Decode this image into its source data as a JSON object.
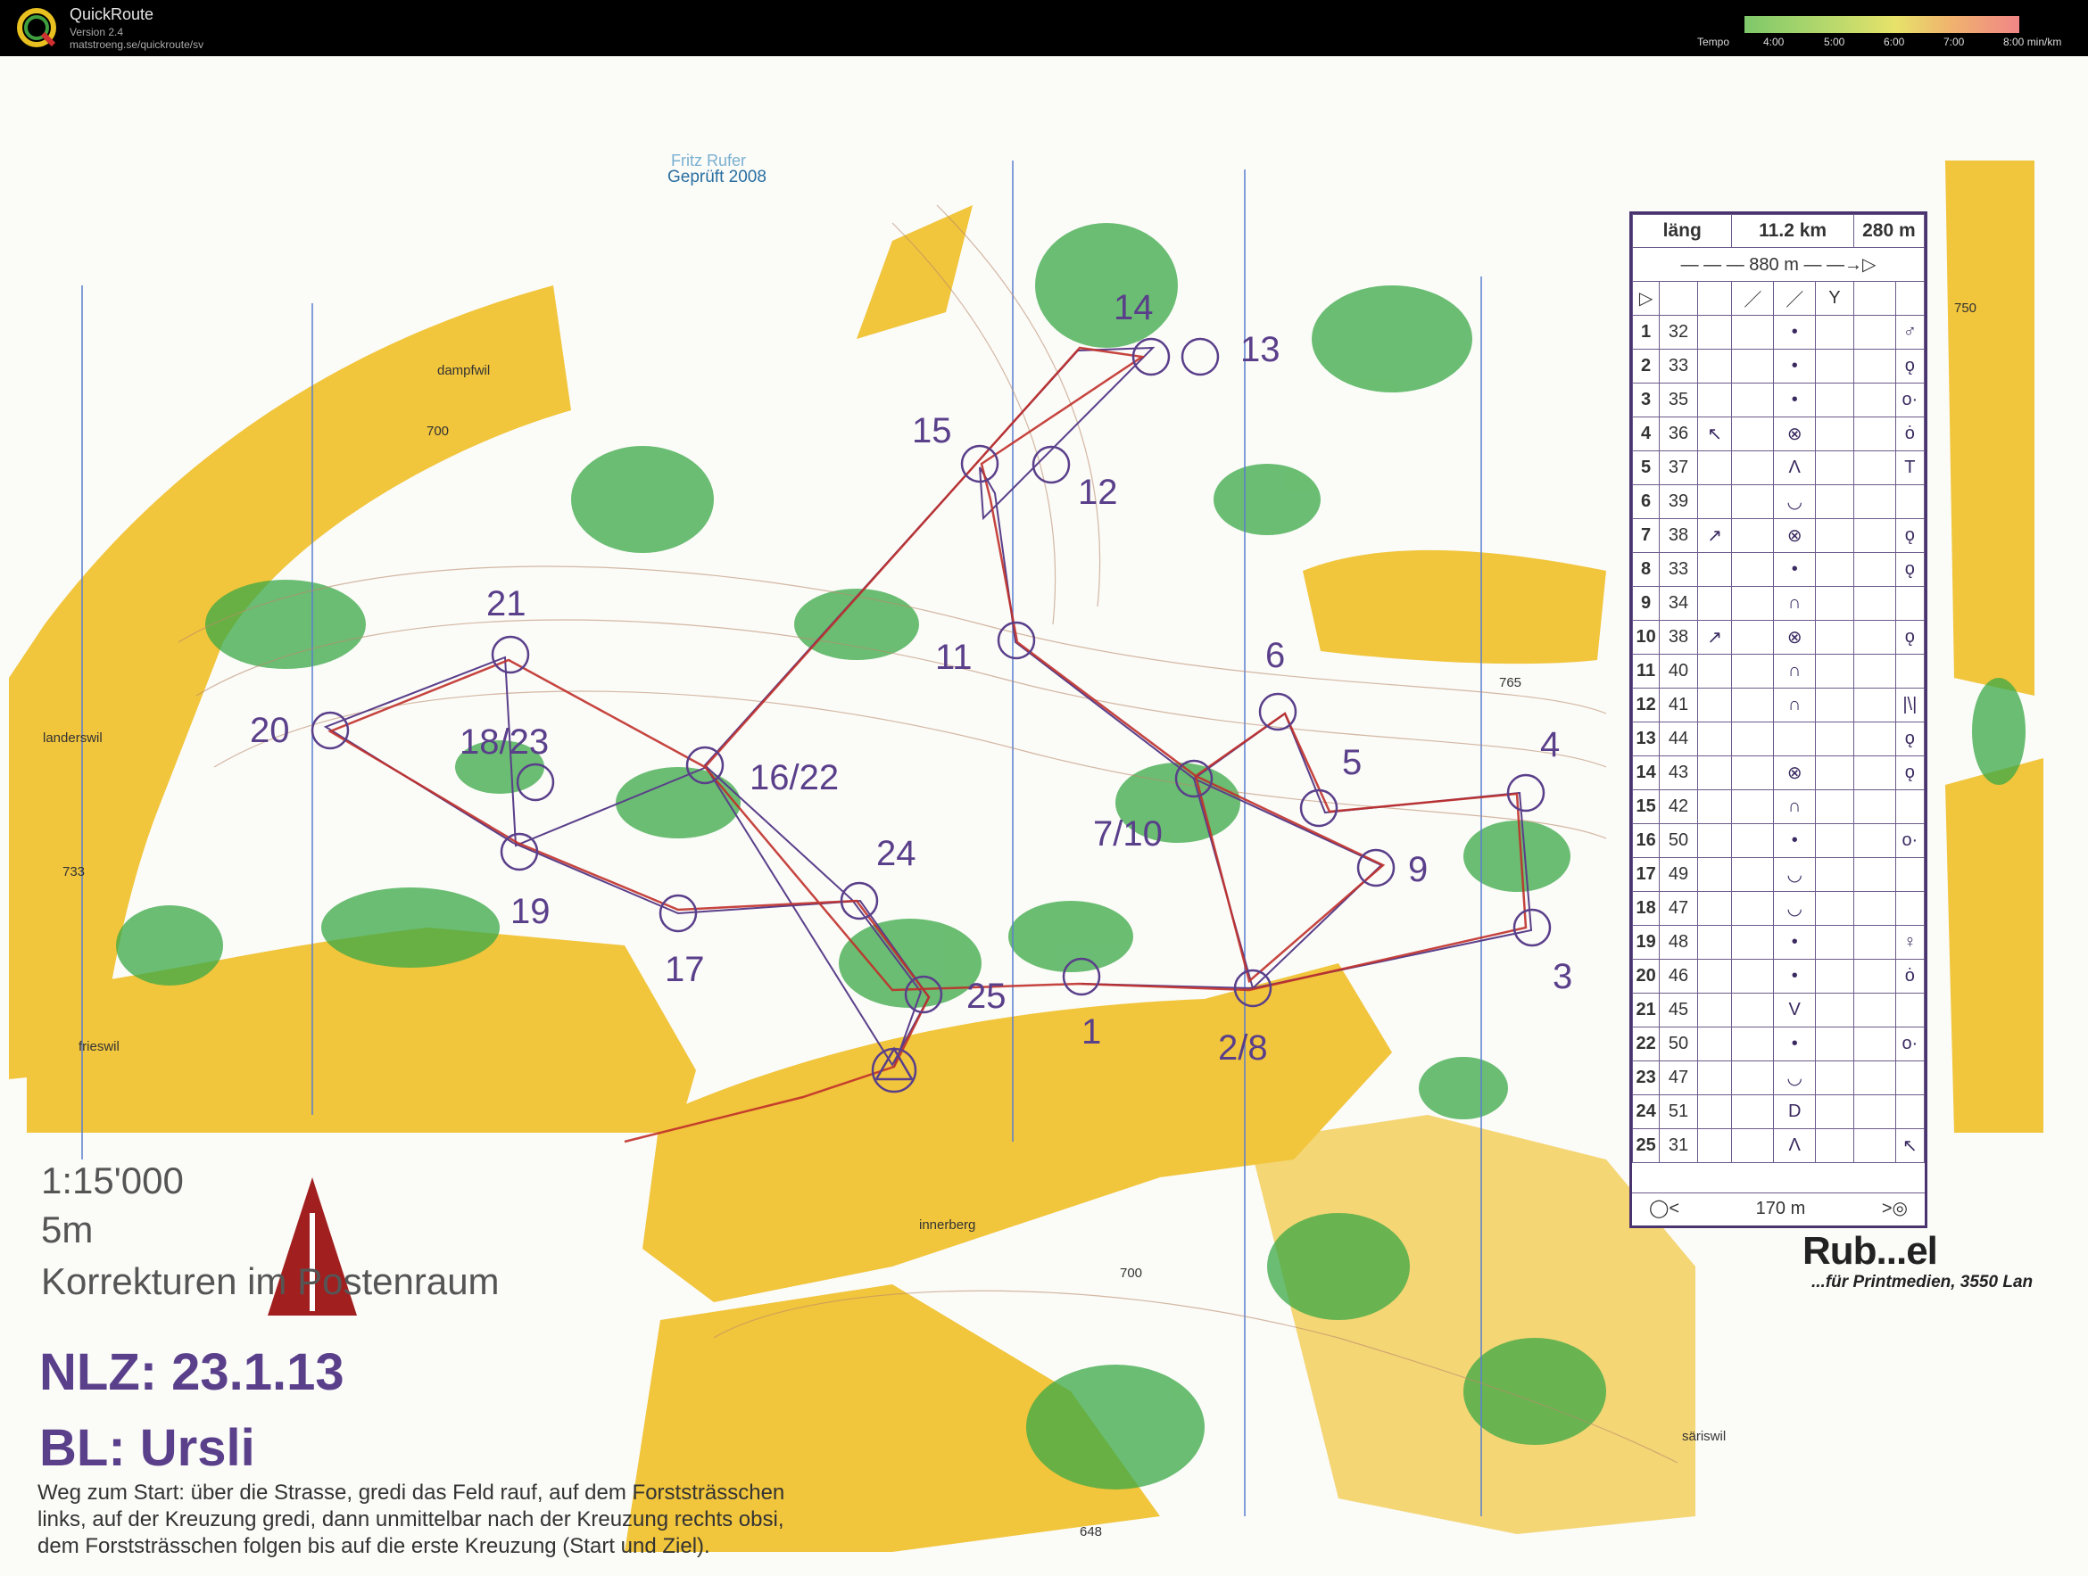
{
  "app": {
    "name": "QuickRoute",
    "version": "Version 2.4",
    "url": "matstroeng.se/quickroute/sv",
    "tempo_label": "Tempo",
    "tempo_ticks": [
      "4:00",
      "5:00",
      "6:00",
      "7:00",
      "8:00  min/km"
    ]
  },
  "map": {
    "checked_by": "Fritz Rufer",
    "checked_year": "Geprüft 2008",
    "scale": "1:15'000",
    "contour": "5m",
    "corrections": "Korrekturen im Postenraum",
    "nlz": "NLZ: 23.1.13",
    "bl": "BL: Ursli",
    "route_lines": [
      "Weg zum Start: über die Strasse, gredi das Feld rauf, auf dem Forststrässchen",
      "links, auf der Kreuzung gredi, dann unmittelbar nach der Kreuzung rechts obsi,",
      "dem Forststrässchen folgen bis auf die erste Kreuzung (Start und Ziel)."
    ],
    "place_names": [
      "dampfwil",
      "landerswil",
      "frieswil",
      "innerberg",
      "säriswil"
    ],
    "heights": [
      "700",
      "733",
      "765",
      "750",
      "700",
      "648"
    ],
    "control_labels": [
      "14",
      "13",
      "15",
      "12",
      "21",
      "11",
      "6",
      "20",
      "18/23",
      "16/22",
      "5",
      "4",
      "24",
      "7/10",
      "9",
      "19",
      "17",
      "25",
      "1",
      "2/8",
      "3"
    ],
    "printer": "Rub...el",
    "printer_sub": "...für Printmedien, 3550 Lan"
  },
  "legend": {
    "length_label": "läng",
    "distance": "11.2 km",
    "climb": "280 m",
    "start_dist": "880 m",
    "finish_dist": "170 m",
    "controls": [
      {
        "n": "1",
        "code": "32",
        "dir": "",
        "feat": "•",
        "det": "♂"
      },
      {
        "n": "2",
        "code": "33",
        "dir": "",
        "feat": "•",
        "det": "ǫ"
      },
      {
        "n": "3",
        "code": "35",
        "dir": "",
        "feat": "•",
        "det": "o·"
      },
      {
        "n": "4",
        "code": "36",
        "dir": "↖",
        "feat": "⊗",
        "det": "ȯ"
      },
      {
        "n": "5",
        "code": "37",
        "dir": "",
        "feat": "Λ",
        "det": "T"
      },
      {
        "n": "6",
        "code": "39",
        "dir": "",
        "feat": "◡",
        "det": ""
      },
      {
        "n": "7",
        "code": "38",
        "dir": "↗",
        "feat": "⊗",
        "det": "ǫ"
      },
      {
        "n": "8",
        "code": "33",
        "dir": "",
        "feat": "•",
        "det": "ǫ"
      },
      {
        "n": "9",
        "code": "34",
        "dir": "",
        "feat": "∩",
        "det": ""
      },
      {
        "n": "10",
        "code": "38",
        "dir": "↗",
        "feat": "⊗",
        "det": "ǫ"
      },
      {
        "n": "11",
        "code": "40",
        "dir": "",
        "feat": "∩",
        "det": ""
      },
      {
        "n": "12",
        "code": "41",
        "dir": "",
        "feat": "∩",
        "det": "|\\|"
      },
      {
        "n": "13",
        "code": "44",
        "dir": "",
        "feat": "",
        "det": "ǫ"
      },
      {
        "n": "14",
        "code": "43",
        "dir": "",
        "feat": "⊗",
        "det": "ǫ"
      },
      {
        "n": "15",
        "code": "42",
        "dir": "",
        "feat": "∩",
        "det": ""
      },
      {
        "n": "16",
        "code": "50",
        "dir": "",
        "feat": "•",
        "det": "o·"
      },
      {
        "n": "17",
        "code": "49",
        "dir": "",
        "feat": "◡",
        "det": ""
      },
      {
        "n": "18",
        "code": "47",
        "dir": "",
        "feat": "◡",
        "det": ""
      },
      {
        "n": "19",
        "code": "48",
        "dir": "",
        "feat": "•",
        "det": "♀"
      },
      {
        "n": "20",
        "code": "46",
        "dir": "",
        "feat": "•",
        "det": "ȯ"
      },
      {
        "n": "21",
        "code": "45",
        "dir": "",
        "feat": "V",
        "det": ""
      },
      {
        "n": "22",
        "code": "50",
        "dir": "",
        "feat": "•",
        "det": "o·"
      },
      {
        "n": "23",
        "code": "47",
        "dir": "",
        "feat": "◡",
        "det": ""
      },
      {
        "n": "24",
        "code": "51",
        "dir": "",
        "feat": "D",
        "det": ""
      },
      {
        "n": "25",
        "code": "31",
        "dir": "",
        "feat": "Λ",
        "det": "↖"
      }
    ]
  }
}
